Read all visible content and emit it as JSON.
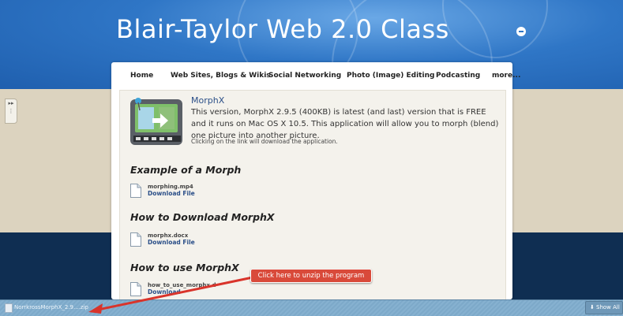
{
  "site": {
    "title": "Blair-Taylor Web 2.0 Class"
  },
  "nav": {
    "items": [
      {
        "label": "Home"
      },
      {
        "label": "Web Sites, Blogs & Wikis"
      },
      {
        "label": "Social Networking"
      },
      {
        "label": "Photo (Image) Editing"
      },
      {
        "label": "Podcasting"
      },
      {
        "label": "more..."
      }
    ]
  },
  "app": {
    "name": "MorphX",
    "description": "This version, MorphX 2.9.5 (400KB) is latest (and last) version that is FREE and it runs on Mac OS X 10.5.  This application will allow you to morph (blend) one picture into another picture.",
    "note": "Clicking on the link will download the application.",
    "icon": "morphx-app-icon"
  },
  "sections": [
    {
      "heading": "Example of a Morph",
      "file": {
        "name": "morphing.mp4",
        "link": "Download File"
      }
    },
    {
      "heading": "How to Download MorphX",
      "file": {
        "name": "morphx.docx",
        "link": "Download File"
      }
    },
    {
      "heading": "How to use MorphX",
      "file": {
        "name": "how_to_use_morphx.d",
        "link": "Download"
      }
    }
  ],
  "callout": {
    "text": "Click here to unzip the program",
    "color": "#d94a3a"
  },
  "downloads": {
    "item": "NorrkrossMorphX_2.9....zip",
    "show_all": "Show All"
  },
  "colors": {
    "header": "#2f76c6",
    "link": "#2b4f88",
    "footer": "#0f2e52"
  }
}
